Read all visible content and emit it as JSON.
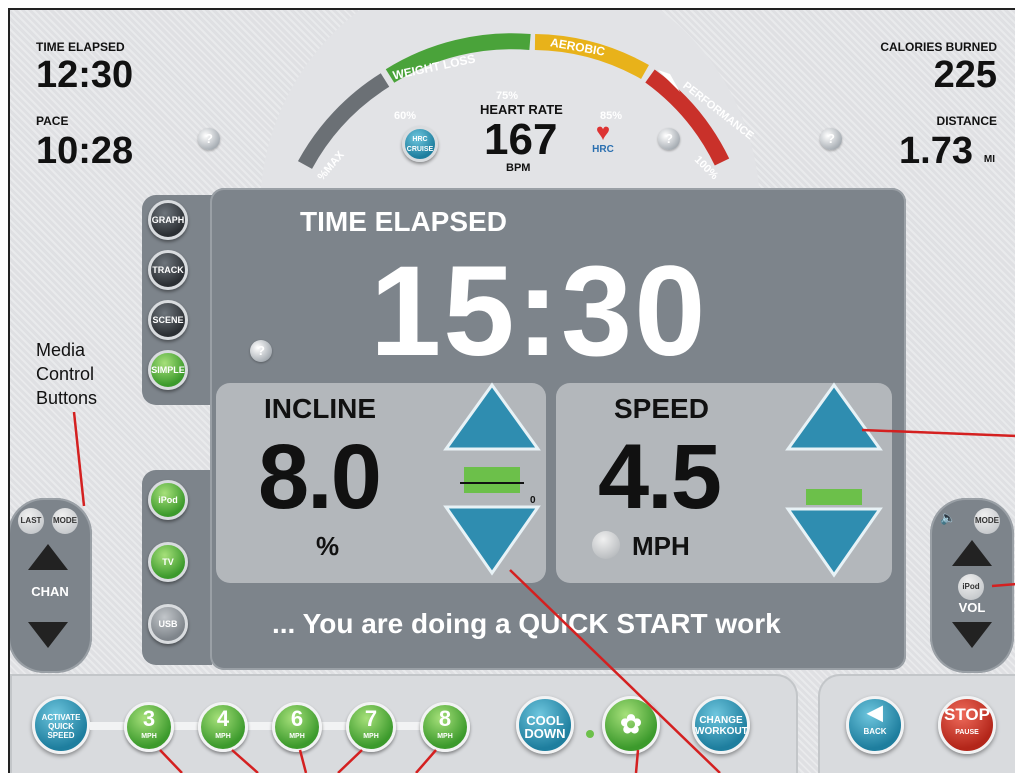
{
  "stats": {
    "time_elapsed_label": "TIME ELAPSED",
    "time_elapsed_value": "12:30",
    "pace_label": "PACE",
    "pace_value": "10:28",
    "calories_label": "CALORIES BURNED",
    "calories_value": "225",
    "distance_label": "DISTANCE",
    "distance_value": "1.73",
    "distance_unit": "MI"
  },
  "gauge": {
    "zone_weight_loss": "WEIGHT LOSS",
    "zone_aerobic": "AEROBIC",
    "zone_performance": "PERFORMANCE",
    "max_label": "%MAX",
    "p60": "60%",
    "p75": "75%",
    "p85": "85%",
    "p100": "100%",
    "heart_rate_label": "HEART RATE",
    "heart_rate_value": "167",
    "bpm": "BPM",
    "hrc_cruise": "HRC CRUISE",
    "hrc": "HRC"
  },
  "view_modes": [
    "GRAPH",
    "TRACK",
    "SCENE",
    "SIMPLE"
  ],
  "media_sources": [
    "iPod",
    "TV",
    "USB"
  ],
  "main": {
    "title": "TIME ELAPSED",
    "time": "15:30",
    "incline_label": "INCLINE",
    "incline_value": "8.0",
    "incline_unit": "%",
    "incline_zero": "0",
    "speed_label": "SPEED",
    "speed_value": "4.5",
    "speed_unit": "MPH",
    "marquee": "... You are doing a QUICK START work"
  },
  "left_ctrl": {
    "last": "LAST",
    "mode": "MODE",
    "chan": "CHAN"
  },
  "right_ctrl": {
    "mode": "MODE",
    "ipod": "iPod",
    "vol": "VOL"
  },
  "bottom": {
    "activate": "ACTIVATE QUICK SPEED",
    "speeds": [
      "3",
      "4",
      "6",
      "7",
      "8"
    ],
    "speed_unit": "MPH",
    "cool_down": "COOL DOWN",
    "change_workout": "CHANGE WORKOUT",
    "back": "BACK",
    "stop": "STOP",
    "pause": "PAUSE"
  },
  "annotation": {
    "media_control": "Media Control Buttons"
  },
  "colors": {
    "accent_blue": "#1e7e9e",
    "green": "#3c9a2c",
    "red": "#b3261a",
    "panel_grey": "#7d848b",
    "annotation_line": "#d42020"
  },
  "question_mark": "?"
}
